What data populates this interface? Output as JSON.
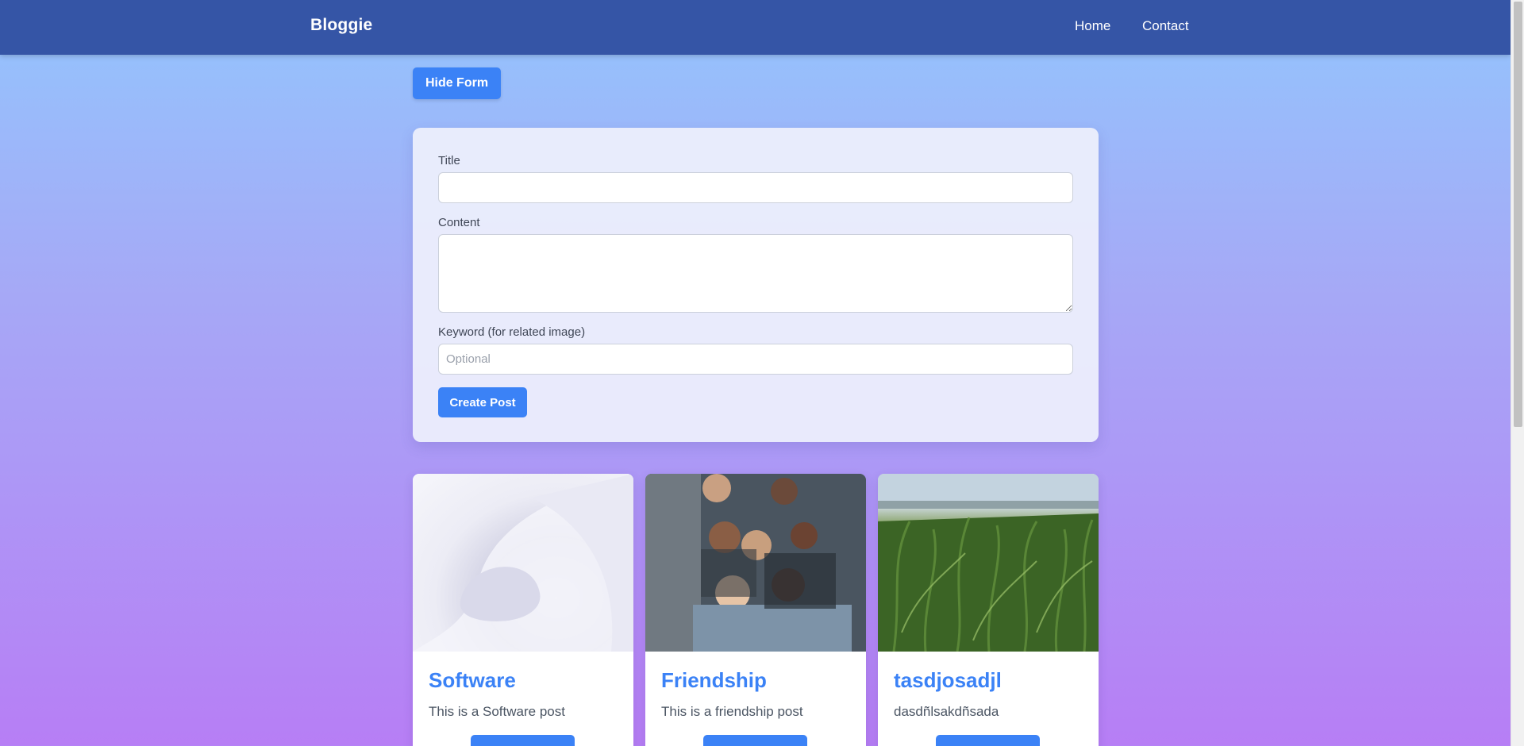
{
  "navbar": {
    "brand": "Bloggie",
    "links": [
      {
        "label": "Home"
      },
      {
        "label": "Contact"
      }
    ]
  },
  "toggle_form": {
    "label": "Hide Form"
  },
  "form": {
    "title_label": "Title",
    "title_value": "",
    "content_label": "Content",
    "content_value": "",
    "keyword_label": "Keyword (for related image)",
    "keyword_value": "",
    "keyword_placeholder": "Optional",
    "submit_label": "Create Post"
  },
  "posts": [
    {
      "title": "Software",
      "excerpt": "This is a Software post",
      "image": "abstract-white-waves-image"
    },
    {
      "title": "Friendship",
      "excerpt": "This is a friendship post",
      "image": "group-of-friends-photo"
    },
    {
      "title": "tasdjosadjl",
      "excerpt": "dasdñlsakdñsada",
      "image": "cornfield-photo"
    }
  ],
  "colors": {
    "navbar": "#3555a6",
    "accent": "#3b82f6",
    "gradient_top": "#93c5fd",
    "gradient_bottom": "#b77ef5"
  }
}
